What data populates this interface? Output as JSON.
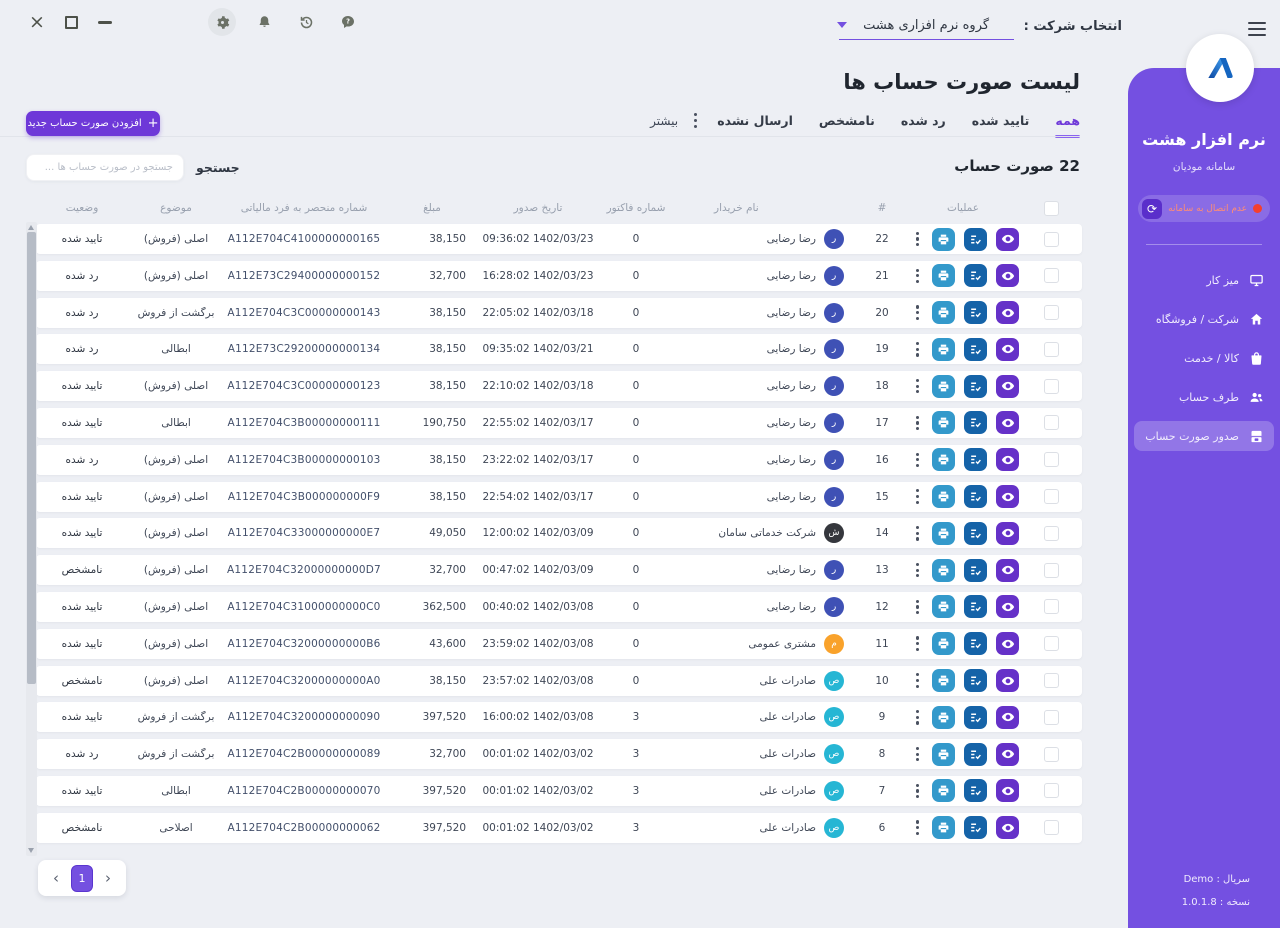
{
  "topbar": {
    "company_label": "انتخاب شرکت :",
    "company_value": "گروه نرم افزاری هشت"
  },
  "sidebar": {
    "app_name": "نرم افزار هشت",
    "app_subtitle": "سامانه مودیان",
    "connection_status": "عدم اتصال به سامانه",
    "items": [
      {
        "label": "میز کار",
        "icon": "desktop-icon"
      },
      {
        "label": "شرکت / فروشگاه",
        "icon": "home-icon"
      },
      {
        "label": "کالا / خدمت",
        "icon": "bag-icon"
      },
      {
        "label": "طرف حساب",
        "icon": "users-icon"
      },
      {
        "label": "صدور صورت حساب",
        "icon": "invoice-icon",
        "active": true
      }
    ],
    "serial": "سریال : Demo",
    "version": "نسخه : 1.0.1.8"
  },
  "main": {
    "title": "لیست صورت حساب ها",
    "tabs": [
      {
        "label": "همه",
        "active": true
      },
      {
        "label": "تایید شده"
      },
      {
        "label": "رد شده"
      },
      {
        "label": "نامشخص"
      },
      {
        "label": "ارسال نشده"
      }
    ],
    "more_label": "بیشتر",
    "add_button_label": "افزودن صورت حساب جدید",
    "count_label": "22 صورت حساب",
    "search_label": "جستجو",
    "search_placeholder": "جستجو در صورت حساب ها ...",
    "table": {
      "headers": [
        "وضعیت",
        "موضوع",
        "شماره منحصر به فرد مالیاتی",
        "مبلغ",
        "تاریخ صدور",
        "شماره فاکتور",
        "نام خریدار",
        "#",
        "عملیات"
      ],
      "rows": [
        {
          "num": "22",
          "buyer": "رضا رضایی",
          "initial": "ر",
          "avatar": "indigo",
          "invoice_no": "0",
          "issue_date": "09:36:02 1402/03/23",
          "amount": "38,150",
          "tax_id": "A112E704C4100000000165",
          "subject": "اصلی (فروش)",
          "status": "تایید شده"
        },
        {
          "num": "21",
          "buyer": "رضا رضایی",
          "initial": "ر",
          "avatar": "indigo",
          "invoice_no": "0",
          "issue_date": "16:28:02 1402/03/23",
          "amount": "32,700",
          "tax_id": "A112E73C29400000000152",
          "subject": "اصلی (فروش)",
          "status": "رد شده"
        },
        {
          "num": "20",
          "buyer": "رضا رضایی",
          "initial": "ر",
          "avatar": "indigo",
          "invoice_no": "0",
          "issue_date": "22:05:02 1402/03/18",
          "amount": "38,150",
          "tax_id": "A112E704C3C00000000143",
          "subject": "برگشت از فروش",
          "status": "رد شده"
        },
        {
          "num": "19",
          "buyer": "رضا رضایی",
          "initial": "ر",
          "avatar": "indigo",
          "invoice_no": "0",
          "issue_date": "09:35:02 1402/03/21",
          "amount": "38,150",
          "tax_id": "A112E73C29200000000134",
          "subject": "ابطالی",
          "status": "رد شده"
        },
        {
          "num": "18",
          "buyer": "رضا رضایی",
          "initial": "ر",
          "avatar": "indigo",
          "invoice_no": "0",
          "issue_date": "22:10:02 1402/03/18",
          "amount": "38,150",
          "tax_id": "A112E704C3C00000000123",
          "subject": "اصلی (فروش)",
          "status": "تایید شده"
        },
        {
          "num": "17",
          "buyer": "رضا رضایی",
          "initial": "ر",
          "avatar": "indigo",
          "invoice_no": "0",
          "issue_date": "22:55:02 1402/03/17",
          "amount": "190,750",
          "tax_id": "A112E704C3B00000000111",
          "subject": "ابطالی",
          "status": "تایید شده"
        },
        {
          "num": "16",
          "buyer": "رضا رضایی",
          "initial": "ر",
          "avatar": "indigo",
          "invoice_no": "0",
          "issue_date": "23:22:02 1402/03/17",
          "amount": "38,150",
          "tax_id": "A112E704C3B00000000103",
          "subject": "اصلی (فروش)",
          "status": "رد شده"
        },
        {
          "num": "15",
          "buyer": "رضا رضایی",
          "initial": "ر",
          "avatar": "indigo",
          "invoice_no": "0",
          "issue_date": "22:54:02 1402/03/17",
          "amount": "38,150",
          "tax_id": "A112E704C3B000000000F9",
          "subject": "اصلی (فروش)",
          "status": "تایید شده"
        },
        {
          "num": "14",
          "buyer": "شرکت خدماتی سامان",
          "initial": "ش",
          "avatar": "dark",
          "invoice_no": "0",
          "issue_date": "12:00:02 1402/03/09",
          "amount": "49,050",
          "tax_id": "A112E704C33000000000E7",
          "subject": "اصلی (فروش)",
          "status": "تایید شده"
        },
        {
          "num": "13",
          "buyer": "رضا رضایی",
          "initial": "ر",
          "avatar": "indigo",
          "invoice_no": "0",
          "issue_date": "00:47:02 1402/03/09",
          "amount": "32,700",
          "tax_id": "A112E704C32000000000D7",
          "subject": "اصلی (فروش)",
          "status": "نامشخص"
        },
        {
          "num": "12",
          "buyer": "رضا رضایی",
          "initial": "ر",
          "avatar": "indigo",
          "invoice_no": "0",
          "issue_date": "00:40:02 1402/03/08",
          "amount": "362,500",
          "tax_id": "A112E704C31000000000C0",
          "subject": "اصلی (فروش)",
          "status": "تایید شده"
        },
        {
          "num": "11",
          "buyer": "مشتری عمومی",
          "initial": "م",
          "avatar": "orange",
          "invoice_no": "0",
          "issue_date": "23:59:02 1402/03/08",
          "amount": "43,600",
          "tax_id": "A112E704C32000000000B6",
          "subject": "اصلی (فروش)",
          "status": "تایید شده"
        },
        {
          "num": "10",
          "buyer": "صادرات علی",
          "initial": "ص",
          "avatar": "cyan",
          "invoice_no": "0",
          "issue_date": "23:57:02 1402/03/08",
          "amount": "38,150",
          "tax_id": "A112E704C32000000000A0",
          "subject": "اصلی (فروش)",
          "status": "نامشخص"
        },
        {
          "num": "9",
          "buyer": "صادرات علی",
          "initial": "ص",
          "avatar": "cyan",
          "invoice_no": "3",
          "issue_date": "16:00:02 1402/03/08",
          "amount": "397,520",
          "tax_id": "A112E704C3200000000090",
          "subject": "برگشت از فروش",
          "status": "تایید شده"
        },
        {
          "num": "8",
          "buyer": "صادرات علی",
          "initial": "ص",
          "avatar": "cyan",
          "invoice_no": "3",
          "issue_date": "00:01:02 1402/03/02",
          "amount": "32,700",
          "tax_id": "A112E704C2B00000000089",
          "subject": "برگشت از فروش",
          "status": "رد شده"
        },
        {
          "num": "7",
          "buyer": "صادرات علی",
          "initial": "ص",
          "avatar": "cyan",
          "invoice_no": "3",
          "issue_date": "00:01:02 1402/03/02",
          "amount": "397,520",
          "tax_id": "A112E704C2B00000000070",
          "subject": "ابطالی",
          "status": "تایید شده"
        },
        {
          "num": "6",
          "buyer": "صادرات علی",
          "initial": "ص",
          "avatar": "cyan",
          "invoice_no": "3",
          "issue_date": "00:01:02 1402/03/02",
          "amount": "397,520",
          "tax_id": "A112E704C2B00000000062",
          "subject": "اصلاحی",
          "status": "نامشخص"
        }
      ]
    },
    "pagination": {
      "current_page": "1"
    }
  },
  "colors": {
    "sidebar": "#7450e1",
    "accent": "#6e38d8",
    "status_red": "#f43f2e",
    "avatars": {
      "indigo": "#3f51b5",
      "dark": "#35373d",
      "orange": "#f9a22b",
      "cyan": "#26b6d4"
    },
    "action_print": "#3399cb",
    "action_edit": "#1563a8",
    "action_view": "#6531c8"
  }
}
